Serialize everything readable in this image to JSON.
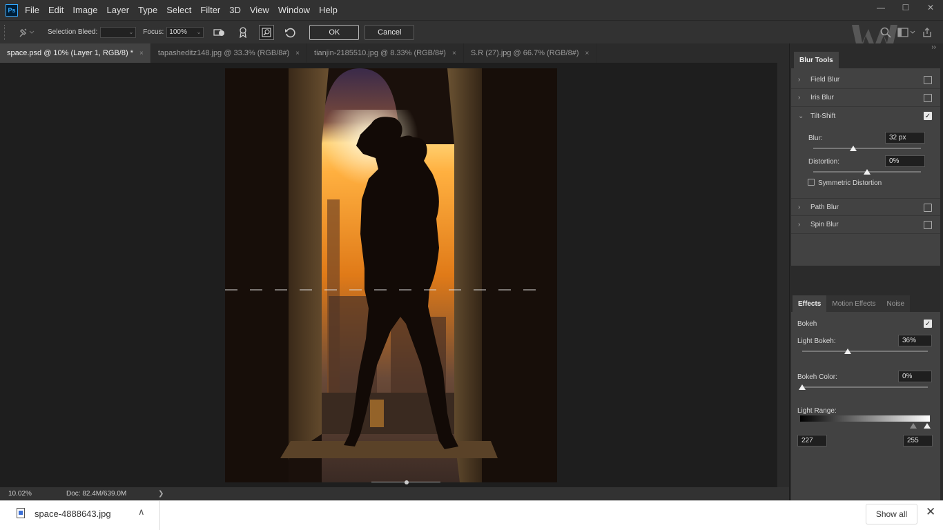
{
  "app": {
    "logo": "Ps",
    "menu": [
      "File",
      "Edit",
      "Image",
      "Layer",
      "Type",
      "Select",
      "Filter",
      "3D",
      "View",
      "Window",
      "Help"
    ],
    "window_controls": {
      "minimize": "—",
      "maximize": "☐",
      "close": "✕"
    }
  },
  "options": {
    "selection_bleed_label": "Selection Bleed:",
    "selection_bleed_value": "",
    "focus_label": "Focus:",
    "focus_value": "100%",
    "ok_label": "OK",
    "cancel_label": "Cancel",
    "icons": [
      "pin-icon",
      "save-mask-icon",
      "high-quality-icon",
      "remove-pins-icon",
      "reset-icon"
    ]
  },
  "tabs": [
    {
      "label": "space.psd @ 10% (Layer 1, RGB/8) *",
      "active": true
    },
    {
      "label": "tapasheditz148.jpg @ 33.3% (RGB/8#)",
      "active": false
    },
    {
      "label": "tianjin-2185510.jpg @ 8.33% (RGB/8#)",
      "active": false
    },
    {
      "label": "S.R (27).jpg @ 66.7% (RGB/8#)",
      "active": false
    }
  ],
  "tab_close": "×",
  "status": {
    "zoom": "10.02%",
    "doc": "Doc: 82.4M/639.0M",
    "arrow": "❯"
  },
  "panel": {
    "collapse": "››",
    "blur_tools_tab": "Blur Tools",
    "blur_tools": [
      {
        "name": "Field Blur",
        "checked": false,
        "expanded": false
      },
      {
        "name": "Iris Blur",
        "checked": false,
        "expanded": false
      },
      {
        "name": "Tilt-Shift",
        "checked": true,
        "expanded": true
      },
      {
        "name": "Path Blur",
        "checked": false,
        "expanded": false
      },
      {
        "name": "Spin Blur",
        "checked": false,
        "expanded": false
      }
    ],
    "tilt_shift": {
      "blur_label": "Blur:",
      "blur_value": "32 px",
      "blur_fraction": 0.37,
      "distortion_label": "Distortion:",
      "distortion_value": "0%",
      "distortion_fraction": 0.5,
      "symmetric_label": "Symmetric Distortion",
      "symmetric_checked": false
    },
    "effects_tabs": [
      "Effects",
      "Motion Effects",
      "Noise"
    ],
    "effects": {
      "bokeh_label": "Bokeh",
      "bokeh_checked": true,
      "light_bokeh_label": "Light Bokeh:",
      "light_bokeh_value": "36%",
      "light_bokeh_fraction": 0.36,
      "bokeh_color_label": "Bokeh Color:",
      "bokeh_color_value": "0%",
      "bokeh_color_fraction": 0.0,
      "light_range_label": "Light Range:",
      "light_range_low": "227",
      "light_range_high": "255"
    }
  },
  "download": {
    "filename": "space-4888643.jpg",
    "show_all_label": "Show all",
    "chevron": "∧",
    "close": "✕"
  },
  "colors": {
    "accent": "#31a8ff",
    "panel_bg": "#2b2b2b",
    "canvas_bg": "#1e1e1e"
  }
}
